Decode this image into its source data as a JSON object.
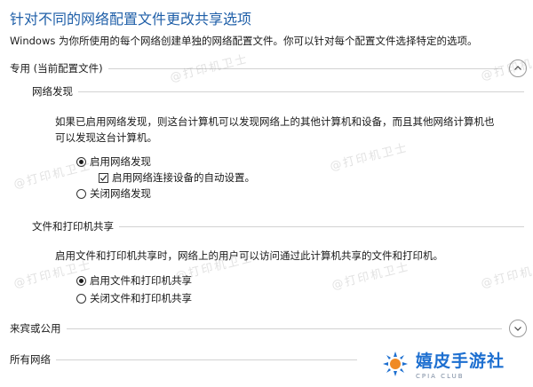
{
  "page": {
    "title": "针对不同的网络配置文件更改共享选项",
    "description": "Windows 为你所使用的每个网络创建单独的网络配置文件。你可以针对每个配置文件选择特定的选项。"
  },
  "sections": {
    "private": {
      "label": "专用 (当前配置文件)",
      "state": "expanded",
      "network_discovery": {
        "label": "网络发现",
        "description_line1": "如果已启用网络发现，则这台计算机可以发现网络上的其他计算机和设备，而且其他网络计算机也",
        "description_line2": "可以发现这台计算机。",
        "options": {
          "on": "启用网络发现",
          "auto_setup": "启用网络连接设备的自动设置。",
          "off": "关闭网络发现"
        },
        "selected": "on",
        "auto_setup_checked": true
      },
      "file_printer_sharing": {
        "label": "文件和打印机共享",
        "description": "启用文件和打印机共享时，网络上的用户可以访问通过此计算机共享的文件和打印机。",
        "options": {
          "on": "启用文件和打印机共享",
          "off": "关闭文件和打印机共享"
        },
        "selected": "on"
      }
    },
    "guest_public": {
      "label": "来宾或公用",
      "state": "collapsed"
    },
    "all_networks": {
      "label": "所有网络",
      "state": "collapsed"
    }
  },
  "watermark": {
    "text": "@打印机卫士"
  },
  "logo": {
    "name": "嬉皮手游社",
    "subtitle": "CPIA CLUB"
  },
  "icons": {
    "expanded": "chevron-up-icon",
    "collapsed": "chevron-down-icon",
    "checkbox": "checkmark-icon"
  },
  "colors": {
    "title": "#1f5fa8",
    "logo": "#1d6fd0"
  }
}
